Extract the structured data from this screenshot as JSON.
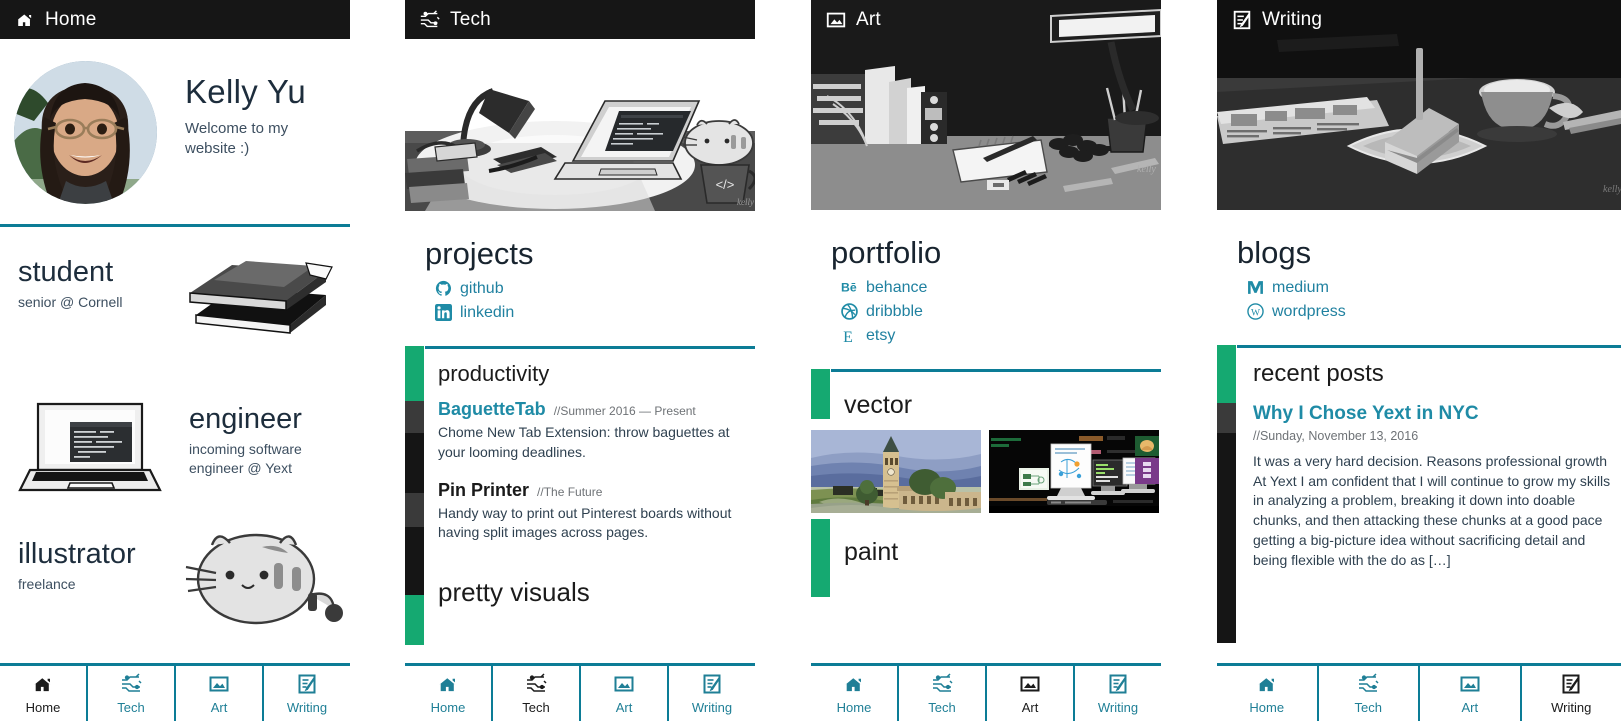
{
  "columns": [
    {
      "id": "home",
      "title": "Home",
      "title_icon": "home-icon",
      "active_nav": "Home",
      "profile": {
        "name": "Kelly Yu",
        "tagline": "Welcome to my website :)",
        "avatar_alt": "photo of Kelly Yu"
      },
      "roles": [
        {
          "heading": "student",
          "subtitle": "senior @ Cornell",
          "art": "books-icon"
        },
        {
          "heading": "engineer",
          "subtitle": "incoming software engineer @ Yext",
          "art": "laptop-icon"
        },
        {
          "heading": "illustrator",
          "subtitle": "freelance",
          "art": "pusheen-cat-icon"
        }
      ]
    },
    {
      "id": "tech",
      "title": "Tech",
      "title_icon": "circuit-icon",
      "active_nav": "Tech",
      "hero_alt": "desk with lamp, laptop, books and cat illustration",
      "section_heading": "projects",
      "links": [
        {
          "label": "github",
          "icon": "github-icon"
        },
        {
          "label": "linkedin",
          "icon": "linkedin-icon"
        }
      ],
      "panels": [
        {
          "heading": "productivity",
          "items": [
            {
              "title": "BaguetteTab",
              "meta": "//Summer 2016 — Present",
              "body": "Chome New Tab Extension: throw baguettes at your looming deadlines."
            },
            {
              "title": "Pin Printer",
              "meta": "//The Future",
              "body": "Handy way to print out Pinterest boards without having split images across pages."
            }
          ]
        },
        {
          "heading": "pretty visuals",
          "items": []
        }
      ]
    },
    {
      "id": "art",
      "title": "Art",
      "title_icon": "image-icon",
      "active_nav": "Art",
      "hero_alt": "dark desk with books, lamp, notebook and pens illustration",
      "section_heading": "portfolio",
      "links": [
        {
          "label": "behance",
          "icon": "behance-icon"
        },
        {
          "label": "dribbble",
          "icon": "dribbble-icon"
        },
        {
          "label": "etsy",
          "icon": "etsy-icon"
        }
      ],
      "panels": [
        {
          "heading": "vector",
          "thumbs": [
            "cornell-clocktower-thumb",
            "monitors-workspace-thumb"
          ]
        },
        {
          "heading": "paint",
          "thumbs": []
        }
      ]
    },
    {
      "id": "writing",
      "title": "Writing",
      "title_icon": "notepad-pen-icon",
      "active_nav": "Writing",
      "hero_alt": "dark table with cake slice, coffee cup and newspaper illustration",
      "section_heading": "blogs",
      "links": [
        {
          "label": "medium",
          "icon": "medium-icon"
        },
        {
          "label": "wordpress",
          "icon": "wordpress-icon"
        }
      ],
      "panels": [
        {
          "heading": "recent posts",
          "posts": [
            {
              "title": "Why I Chose Yext in NYC",
              "date": "//Sunday, November 13, 2016",
              "excerpt": "It was a very hard decision. Reasons professional growth At Yext I am confident that I will continue to grow my skills in analyzing a problem, breaking it down into doable chunks, and then attacking these chunks at a good pace getting a big-picture idea without sacrificing detail and being flexible with the do as […]"
            }
          ]
        }
      ]
    }
  ],
  "bottom_nav": [
    {
      "label": "Home",
      "icon": "home-icon"
    },
    {
      "label": "Tech",
      "icon": "circuit-icon"
    },
    {
      "label": "Art",
      "icon": "image-icon"
    },
    {
      "label": "Writing",
      "icon": "notepad-pen-icon"
    }
  ],
  "colors": {
    "teal": "#0c7c96",
    "link_teal": "#2081a0",
    "green_accent": "#15a971",
    "titlebar_black": "#161616",
    "scroll_dark": "#151515",
    "scroll_dark_light": "#3a3a3a",
    "text_dark": "#1d2d3c"
  }
}
